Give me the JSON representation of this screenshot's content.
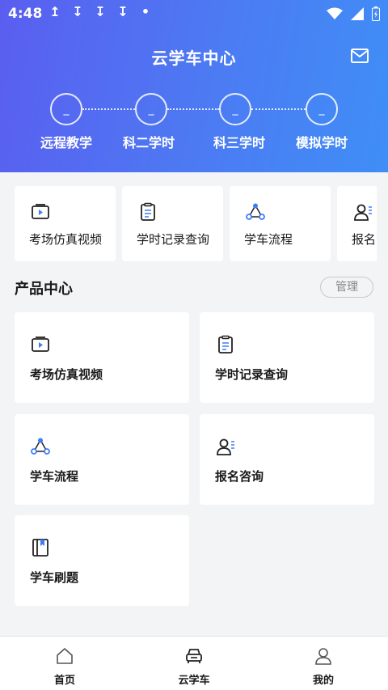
{
  "status_bar": {
    "time": "4:48",
    "notif_icons": [
      "↥",
      "↧",
      "↧",
      "↧",
      "•"
    ]
  },
  "header": {
    "title": "云学车中心"
  },
  "steps": [
    {
      "value": "_",
      "label": "远程教学"
    },
    {
      "value": "_",
      "label": "科二学时"
    },
    {
      "value": "_",
      "label": "科三学时"
    },
    {
      "value": "_",
      "label": "模拟学时"
    }
  ],
  "quick_items": [
    {
      "label": "考场仿真视频",
      "icon": "video-icon"
    },
    {
      "label": "学时记录查询",
      "icon": "clipboard-icon"
    },
    {
      "label": "学车流程",
      "icon": "flow-icon"
    },
    {
      "label": "报名咨询",
      "icon": "user-list-icon"
    }
  ],
  "product_center": {
    "title": "产品中心",
    "manage_label": "管理",
    "items": [
      {
        "label": "考场仿真视频",
        "icon": "video-icon"
      },
      {
        "label": "学时记录查询",
        "icon": "clipboard-icon"
      },
      {
        "label": "学车流程",
        "icon": "flow-icon"
      },
      {
        "label": "报名咨询",
        "icon": "user-list-icon"
      },
      {
        "label": "学车刷题",
        "icon": "book-icon"
      }
    ]
  },
  "bottom_nav": [
    {
      "label": "首页",
      "icon": "home-icon",
      "active": false
    },
    {
      "label": "云学车",
      "icon": "car-icon",
      "active": true
    },
    {
      "label": "我的",
      "icon": "profile-icon",
      "active": false
    }
  ],
  "colors": {
    "accent": "#4c7bf3",
    "icon_blue": "#3f7cf6",
    "icon_dark": "#222222"
  }
}
